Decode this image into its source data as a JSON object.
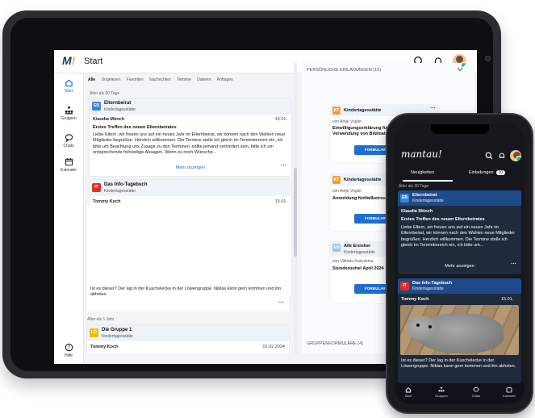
{
  "app": {
    "title": "Start",
    "logo": "M!"
  },
  "sidebar": {
    "items": [
      {
        "label": "Start",
        "icon": "home-icon"
      },
      {
        "label": "Gruppen",
        "icon": "groups-icon"
      },
      {
        "label": "Chats",
        "icon": "chat-icon"
      },
      {
        "label": "Kalender",
        "icon": "calendar-icon"
      },
      {
        "label": "Hilfe",
        "icon": "help-icon"
      }
    ]
  },
  "feed": {
    "tabs": [
      "Alle",
      "Ungelesen",
      "Favoriten",
      "Nachrichten",
      "Termine",
      "Dateien",
      "Anfragen"
    ],
    "age_old30": "Älter als 30 Tage",
    "age_old1y": "Älter als 1 Jahr",
    "card1": {
      "badge": "EB",
      "group": "Elternbeirat",
      "type": "Kindertagesstätte",
      "author": "Klaudia Mönch",
      "date": "15.01.",
      "title": "Erstes Treffen des neuen Elternbeirates",
      "body": "Liebe Eltern, wir freuen uns auf ein neues Jahr im Elternbeirat, wir können nach den Wahlen neue Mitglieder begrüßen. Herzlich willkommen. Die Termine stelle ich gleich im Terminbereich ein, ich bitte um Beachtung uns Zusage zu den Terminen, sollte jemand verhindert sein, bitte ich um entsprechende frühzeitige Absagen. Wenn es noch Wünsche...",
      "more": "Mehr anzeigen"
    },
    "card2": {
      "badge": "IT",
      "group": "Das Info-Tagebuch",
      "type": "Kindertagesstätte",
      "author": "Tommy Koch",
      "date": "15.01.",
      "body": "Ist es dieser? Der lag in der Kuschelecke in der Löwengruppe. Niklas kann gern kommen und ihn abholen."
    },
    "card3": {
      "badge": "LÖ",
      "group": "Die Gruppe 1",
      "type": "Kindertagesstätte",
      "author": "Tommy Koch",
      "date": "01.02.2024"
    }
  },
  "invites": {
    "header": "PERSÖNLICHE EINLADUNGEN (10)",
    "items": [
      {
        "badge": "KT",
        "group": "Kindertagesstätte",
        "from": "von Antje Vogler",
        "title": "Einwilligungserklärung für Verwendung von Bildmaterial",
        "button": "FORMULAR AUSFÜLLEN"
      },
      {
        "badge": "KT",
        "group": "Kindertagesstätte",
        "from": "von Antje Vogler",
        "title": "Anmeldung Notfallbetreuung",
        "button": "FORMULAR AUSFÜLLEN"
      },
      {
        "badge": "EB",
        "group": "Alle Erzieher",
        "type": "Kindertagesstätte",
        "from": "von Viktoria Kubyskina",
        "title": "Stundenzettel April 2024",
        "button": "FORMULAR AUSFÜLLEN"
      }
    ],
    "group_forms": "GRUPPENFORMULARE (4)"
  },
  "phone": {
    "logo": "mantau!",
    "tabs": [
      {
        "label": "Neuigkeiten"
      },
      {
        "label": "Einladungen",
        "count": "10"
      }
    ],
    "age": "Älter als 30 Tage",
    "card1": {
      "badge": "EB",
      "group": "Elternbeirat",
      "type": "Kindertagesstätte",
      "author": "Klaudia Mönch",
      "title": "Erstes Treffen des neuen Elternbeirates",
      "body": "Liebe Eltern, wir freuen uns auf ein neues Jahr im Elternbeirat, wir können nach den Wahlen neue Mitglieder begrüßen. Herzlich willkommen. Die Termine stelle ich gleich im Terminbereich ein, ich bitte um...",
      "more": "Mehr anzeigen"
    },
    "card2": {
      "badge": "IT",
      "group": "Das Info-Tagebuch",
      "type": "Kindertagesstätte",
      "author": "Tommy Koch",
      "date": "15.01.",
      "body": "Ist es dieser? Der lag in der Kuschelecke in der Löwengruppe. Niklas kann gern kommen und ihn abholen."
    },
    "nav": [
      "Start",
      "Gruppen",
      "Chats",
      "Kalender"
    ]
  },
  "colors": {
    "accent": "#1f6fd0",
    "eb": "#3a86d4",
    "it": "#d9322b",
    "kt": "#f0a030",
    "lo": "#e6c200",
    "phone_card": "#1e4a8a"
  }
}
